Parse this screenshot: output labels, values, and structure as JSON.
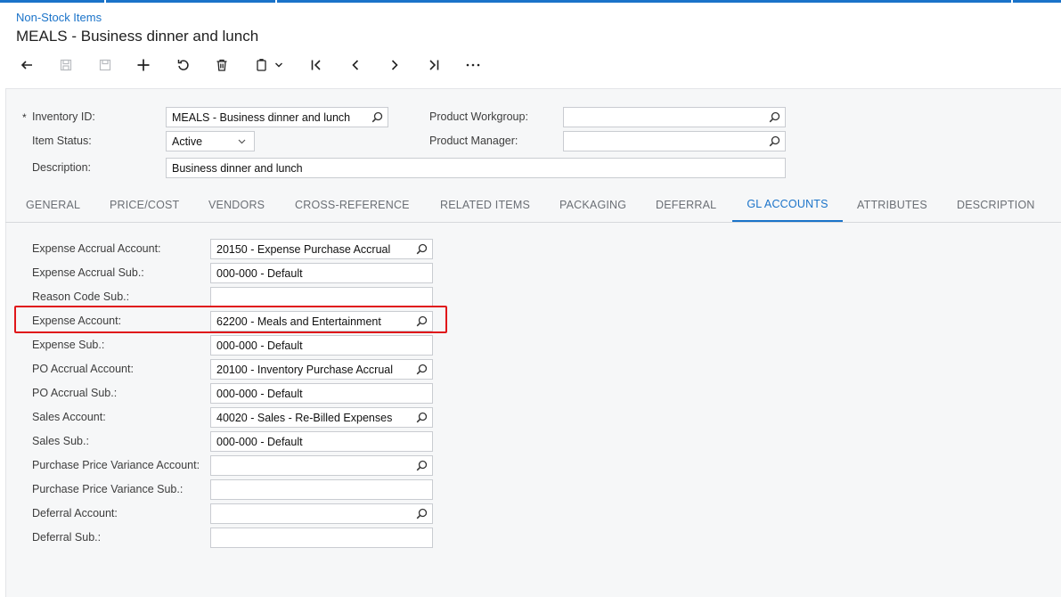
{
  "breadcrumb": "Non-Stock Items",
  "title": "MEALS - Business dinner and lunch",
  "toolbar": {
    "buttons": [
      {
        "icon": "back-arrow-icon",
        "enabled": true
      },
      {
        "icon": "save-close-icon",
        "enabled": false
      },
      {
        "icon": "save-icon",
        "enabled": false
      },
      {
        "icon": "plus-icon",
        "enabled": true
      },
      {
        "icon": "undo-icon",
        "enabled": true
      },
      {
        "icon": "trash-icon",
        "enabled": true
      },
      {
        "icon": "copy-paste-icon",
        "enabled": true
      },
      {
        "icon": "first-record-icon",
        "enabled": true
      },
      {
        "icon": "previous-record-icon",
        "enabled": true
      },
      {
        "icon": "next-record-icon",
        "enabled": true
      },
      {
        "icon": "last-record-icon",
        "enabled": true
      },
      {
        "icon": "more-icon",
        "enabled": true
      }
    ]
  },
  "header": {
    "inventory_id": {
      "label": "Inventory ID:",
      "value": "MEALS - Business dinner and lunch",
      "required_mark": "*"
    },
    "item_status": {
      "label": "Item Status:",
      "value": "Active"
    },
    "description": {
      "label": "Description:",
      "value": "Business dinner and lunch"
    },
    "product_workgroup": {
      "label": "Product Workgroup:",
      "value": ""
    },
    "product_manager": {
      "label": "Product Manager:",
      "value": ""
    }
  },
  "tabs": [
    {
      "label": "GENERAL",
      "active": false
    },
    {
      "label": "PRICE/COST",
      "active": false
    },
    {
      "label": "VENDORS",
      "active": false
    },
    {
      "label": "CROSS-REFERENCE",
      "active": false
    },
    {
      "label": "RELATED ITEMS",
      "active": false
    },
    {
      "label": "PACKAGING",
      "active": false
    },
    {
      "label": "DEFERRAL",
      "active": false
    },
    {
      "label": "GL ACCOUNTS",
      "active": true
    },
    {
      "label": "ATTRIBUTES",
      "active": false
    },
    {
      "label": "DESCRIPTION",
      "active": false
    }
  ],
  "gl_accounts": [
    {
      "label": "Expense Accrual Account:",
      "value": "20150 - Expense Purchase Accrual",
      "lookup": true
    },
    {
      "label": "Expense Accrual Sub.:",
      "value": "000-000 - Default",
      "lookup": false
    },
    {
      "label": "Reason Code Sub.:",
      "value": "",
      "lookup": false
    },
    {
      "label": "Expense Account:",
      "value": "62200 - Meals and Entertainment",
      "lookup": true,
      "highlighted": true
    },
    {
      "label": "Expense Sub.:",
      "value": "000-000 - Default",
      "lookup": false
    },
    {
      "label": "PO Accrual Account:",
      "value": "20100 - Inventory Purchase Accrual",
      "lookup": true
    },
    {
      "label": "PO Accrual Sub.:",
      "value": "000-000 - Default",
      "lookup": false
    },
    {
      "label": "Sales Account:",
      "value": "40020 - Sales - Re-Billed Expenses",
      "lookup": true
    },
    {
      "label": "Sales Sub.:",
      "value": "000-000 - Default",
      "lookup": false
    },
    {
      "label": "Purchase Price Variance Account:",
      "value": "",
      "lookup": true
    },
    {
      "label": "Purchase Price Variance Sub.:",
      "value": "",
      "lookup": false
    },
    {
      "label": "Deferral Account:",
      "value": "",
      "lookup": true
    },
    {
      "label": "Deferral Sub.:",
      "value": "",
      "lookup": false
    }
  ],
  "colors": {
    "accent": "#1a73c9",
    "highlight": "#e0161a",
    "panel": "#f6f7f8"
  }
}
